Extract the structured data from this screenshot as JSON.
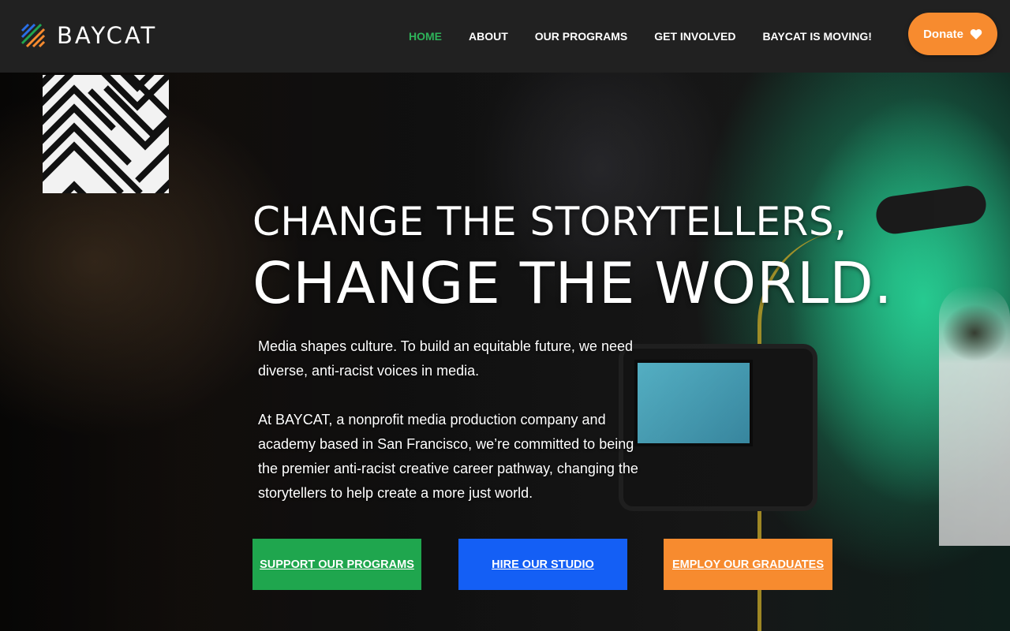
{
  "brand": {
    "name": "BAYCAT",
    "colors": {
      "green": "#1fa64e",
      "blue": "#145ff5",
      "orange": "#f78b2f",
      "nav_active": "#2eb35a",
      "header_bg": "#212121"
    }
  },
  "nav": {
    "items": [
      {
        "label": "HOME",
        "active": true
      },
      {
        "label": "ABOUT",
        "active": false
      },
      {
        "label": "OUR PROGRAMS",
        "active": false
      },
      {
        "label": "GET INVOLVED",
        "active": false
      },
      {
        "label": "BAYCAT IS MOVING!",
        "active": false
      }
    ]
  },
  "donate": {
    "label": "Donate",
    "icon": "heart-icon"
  },
  "hero": {
    "headline_line1": "CHANGE THE STORYTELLERS,",
    "headline_line2": "CHANGE THE WORLD.",
    "paragraph1": "Media shapes culture. To build an equitable future, we need diverse, anti-racist voices in media.",
    "paragraph2": "At BAYCAT, a nonprofit media production company and academy based in San Francisco, we’re committed to being the premier anti-racist creative career pathway, changing the storytellers to help create a more just world.",
    "buttons": [
      {
        "label": "SUPPORT OUR PROGRAMS",
        "color": "#1fa64e"
      },
      {
        "label": "HIRE OUR STUDIO",
        "color": "#145ff5"
      },
      {
        "label": "EMPLOY OUR GRADUATES",
        "color": "#f78b2f"
      }
    ]
  }
}
